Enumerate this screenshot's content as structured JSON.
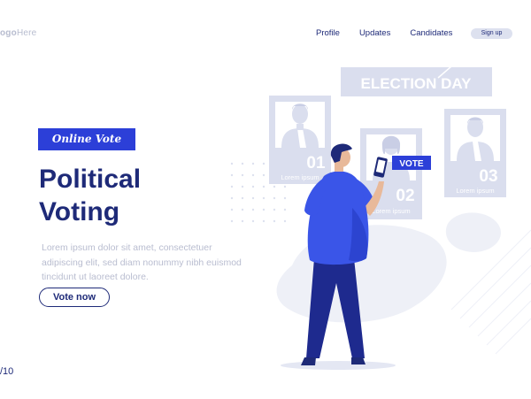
{
  "logo": {
    "prefix": "ogo",
    "suffix": "Here"
  },
  "nav": {
    "items": [
      "Profile",
      "Updates",
      "Candidates"
    ],
    "signup": "Sign up"
  },
  "hero": {
    "badge": "Online Vote",
    "title_line1": "Political",
    "title_line2": "Voting",
    "body": "Lorem ipsum dolor sit amet, consectetuer adipiscing elit, sed diam nonummy nibh euismod tincidunt ut laoreet dolore.",
    "cta": "Vote now"
  },
  "page_indicator": "/10",
  "illustration": {
    "banner": "ELECTION DAY",
    "vote_label": "VOTE",
    "candidates": [
      {
        "number": "01",
        "caption": "Lorem ipsum"
      },
      {
        "number": "02",
        "caption": "Lorem ipsum"
      },
      {
        "number": "03",
        "caption": "Lorem ipsum"
      }
    ]
  },
  "colors": {
    "navy": "#1e2a78",
    "accent_blue": "#2c3fd8",
    "shirt_blue": "#3a55e8",
    "card_gray": "#dadeee",
    "muted_text": "#b9bdd0"
  }
}
